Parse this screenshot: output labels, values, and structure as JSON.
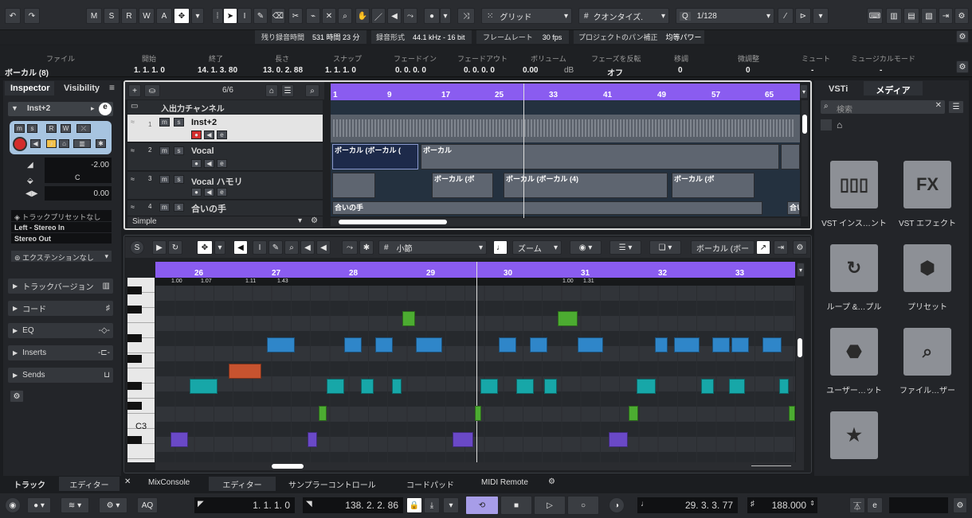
{
  "toolbar": {
    "mode_buttons": [
      "M",
      "S",
      "R",
      "W",
      "A"
    ],
    "grid_label": "グリッド",
    "quantize_label": "クオンタイズ.",
    "quantize_value": "1/128"
  },
  "status": {
    "rec_time_label": "残り録音時間",
    "rec_time_value": "531 時間 23 分",
    "format_label": "録音形式",
    "format_value": "44.1 kHz - 16 bit",
    "framerate_label": "フレームレート",
    "framerate_value": "30 fps",
    "pan_label": "プロジェクトのパン補正",
    "pan_value": "均等パワー"
  },
  "infoline": {
    "headers": [
      "ファイル",
      "開始",
      "終了",
      "長さ",
      "スナップ",
      "フェードイン",
      "フェードアウト",
      "ボリューム",
      "フェーズを反転",
      "移調",
      "微調整",
      "ミュート",
      "ミュージカルモード"
    ],
    "values": [
      "ボーカル (8)",
      "1. 1. 1. 0",
      "14. 1. 3. 80",
      "13. 0. 2. 88",
      "1. 1. 1. 0",
      "0. 0. 0. 0",
      "0. 0. 0. 0",
      "0.00",
      "dB",
      "オフ",
      "0",
      "0",
      "-",
      "-"
    ]
  },
  "inspector": {
    "tab_inspector": "Inspector",
    "tab_visibility": "Visibility",
    "track_name": "Inst+2",
    "volume": "-2.00",
    "pan": "C",
    "delay": "0.00",
    "preset": "トラックプリセットなし",
    "input": "Left - Stereo In",
    "output": "Stereo Out",
    "extension": "エクステンションなし",
    "sections": [
      "トラックバージョン",
      "コード",
      "EQ",
      "Inserts",
      "Sends"
    ]
  },
  "tracklist": {
    "count": "6/6",
    "folder": "入出力チャンネル",
    "tracks": [
      {
        "num": "1",
        "name": "Inst+2"
      },
      {
        "num": "2",
        "name": "Vocal"
      },
      {
        "num": "3",
        "name": "Vocal ハモリ"
      },
      {
        "num": "4",
        "name": "合いの手"
      }
    ],
    "view_mode": "Simple"
  },
  "ruler": {
    "bars": [
      "1",
      "9",
      "17",
      "25",
      "33",
      "41",
      "49",
      "57",
      "65"
    ]
  },
  "clips": {
    "vocal": [
      "ボーカル (ボーカル (",
      "ボーカル"
    ],
    "harmony": [
      "ボーカル (ボ",
      "ボーカル (ボーカル (4)",
      "ボーカル (ボ"
    ],
    "aino": [
      "合いの手",
      "合い"
    ]
  },
  "editor": {
    "grid": "小節",
    "zoom": "ズーム",
    "clip_name": "ボーカル (ボー",
    "bars": [
      "26",
      "27",
      "28",
      "29",
      "30",
      "31",
      "32",
      "33"
    ],
    "tempos": [
      "1.00",
      "1.07",
      "1.11",
      "1.43",
      "1.00",
      "1.31"
    ],
    "key_label": "C3"
  },
  "media": {
    "tab_vsti": "VSTi",
    "tab_media": "メディア",
    "search_placeholder": "検索",
    "tiles": [
      "VST インス…ント",
      "VST エフェクト",
      "ループ &…プル",
      "プリセット",
      "ユーザー…ット",
      "ファイル…ザー"
    ]
  },
  "bottom_tabs": [
    "トラック",
    "エディター",
    "MixConsole",
    "エディター",
    "サンプラーコントロール",
    "コードパッド",
    "MIDI Remote"
  ],
  "transport": {
    "aq": "AQ",
    "left_locator": "1. 1. 1. 0",
    "right_locator": "138. 2. 2. 86",
    "position": "29. 3. 3. 77",
    "tempo": "188.000"
  }
}
